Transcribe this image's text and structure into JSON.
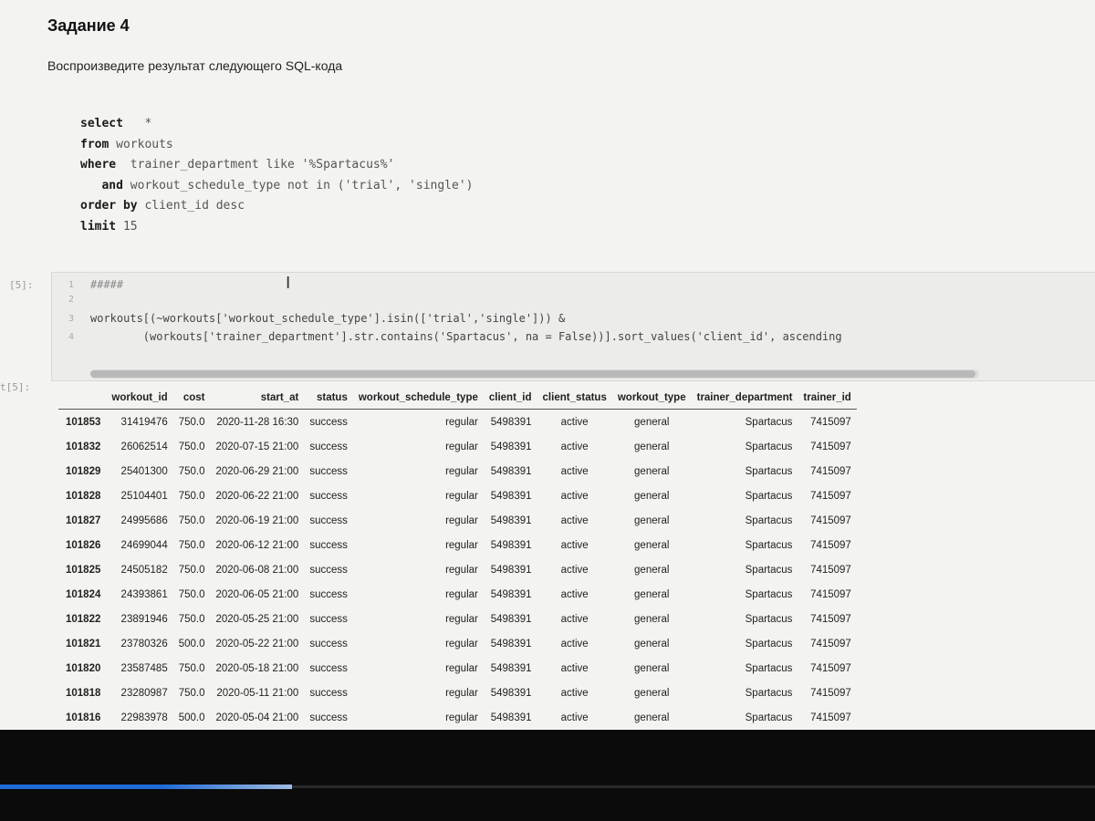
{
  "page": {
    "title": "Задание 4",
    "subtitle": "Воспроизведите результат следующего SQL-кода"
  },
  "sql": {
    "lines": [
      {
        "kw": "select",
        "rest": "   *"
      },
      {
        "kw": "from",
        "rest": " workouts"
      },
      {
        "kw": "where",
        "rest": "  trainer_department like '%Spartacus%'"
      },
      {
        "kw": "   and",
        "rest": " workout_schedule_type not in ('trial', 'single')"
      },
      {
        "kw": "order by",
        "rest": " client_id desc"
      },
      {
        "kw": "limit",
        "rest": " 15"
      }
    ]
  },
  "code_cell": {
    "prompt": "[5]:",
    "line_numbers": [
      "1",
      "2",
      "3",
      "4"
    ],
    "lines": [
      "#####",
      "",
      "workouts[(~workouts['workout_schedule_type'].isin(['trial','single'])) &",
      "        (workouts['trainer_department'].str.contains('Spartacus', na = False))].sort_values('client_id', ascending"
    ]
  },
  "output": {
    "prompt": "t[5]:",
    "columns": [
      "",
      "workout_id",
      "cost",
      "start_at",
      "status",
      "workout_schedule_type",
      "client_id",
      "client_status",
      "workout_type",
      "trainer_department",
      "trainer_id"
    ],
    "rows": [
      [
        "101853",
        "31419476",
        "750.0",
        "2020-11-28 16:30",
        "success",
        "regular",
        "5498391",
        "active",
        "general",
        "Spartacus",
        "7415097"
      ],
      [
        "101832",
        "26062514",
        "750.0",
        "2020-07-15 21:00",
        "success",
        "regular",
        "5498391",
        "active",
        "general",
        "Spartacus",
        "7415097"
      ],
      [
        "101829",
        "25401300",
        "750.0",
        "2020-06-29 21:00",
        "success",
        "regular",
        "5498391",
        "active",
        "general",
        "Spartacus",
        "7415097"
      ],
      [
        "101828",
        "25104401",
        "750.0",
        "2020-06-22 21:00",
        "success",
        "regular",
        "5498391",
        "active",
        "general",
        "Spartacus",
        "7415097"
      ],
      [
        "101827",
        "24995686",
        "750.0",
        "2020-06-19 21:00",
        "success",
        "regular",
        "5498391",
        "active",
        "general",
        "Spartacus",
        "7415097"
      ],
      [
        "101826",
        "24699044",
        "750.0",
        "2020-06-12 21:00",
        "success",
        "regular",
        "5498391",
        "active",
        "general",
        "Spartacus",
        "7415097"
      ],
      [
        "101825",
        "24505182",
        "750.0",
        "2020-06-08 21:00",
        "success",
        "regular",
        "5498391",
        "active",
        "general",
        "Spartacus",
        "7415097"
      ],
      [
        "101824",
        "24393861",
        "750.0",
        "2020-06-05 21:00",
        "success",
        "regular",
        "5498391",
        "active",
        "general",
        "Spartacus",
        "7415097"
      ],
      [
        "101822",
        "23891946",
        "750.0",
        "2020-05-25 21:00",
        "success",
        "regular",
        "5498391",
        "active",
        "general",
        "Spartacus",
        "7415097"
      ],
      [
        "101821",
        "23780326",
        "500.0",
        "2020-05-22 21:00",
        "success",
        "regular",
        "5498391",
        "active",
        "general",
        "Spartacus",
        "7415097"
      ],
      [
        "101820",
        "23587485",
        "750.0",
        "2020-05-18 21:00",
        "success",
        "regular",
        "5498391",
        "active",
        "general",
        "Spartacus",
        "7415097"
      ],
      [
        "101818",
        "23280987",
        "750.0",
        "2020-05-11 21:00",
        "success",
        "regular",
        "5498391",
        "active",
        "general",
        "Spartacus",
        "7415097"
      ],
      [
        "101816",
        "22983978",
        "500.0",
        "2020-05-04 21:00",
        "success",
        "regular",
        "5498391",
        "active",
        "general",
        "Spartacus",
        "7415097"
      ]
    ]
  },
  "colors": {
    "page_bg": "#f3f3f1",
    "code_bg": "#ececeb",
    "string": "#c9757a",
    "progress": "#1f6bd6"
  }
}
